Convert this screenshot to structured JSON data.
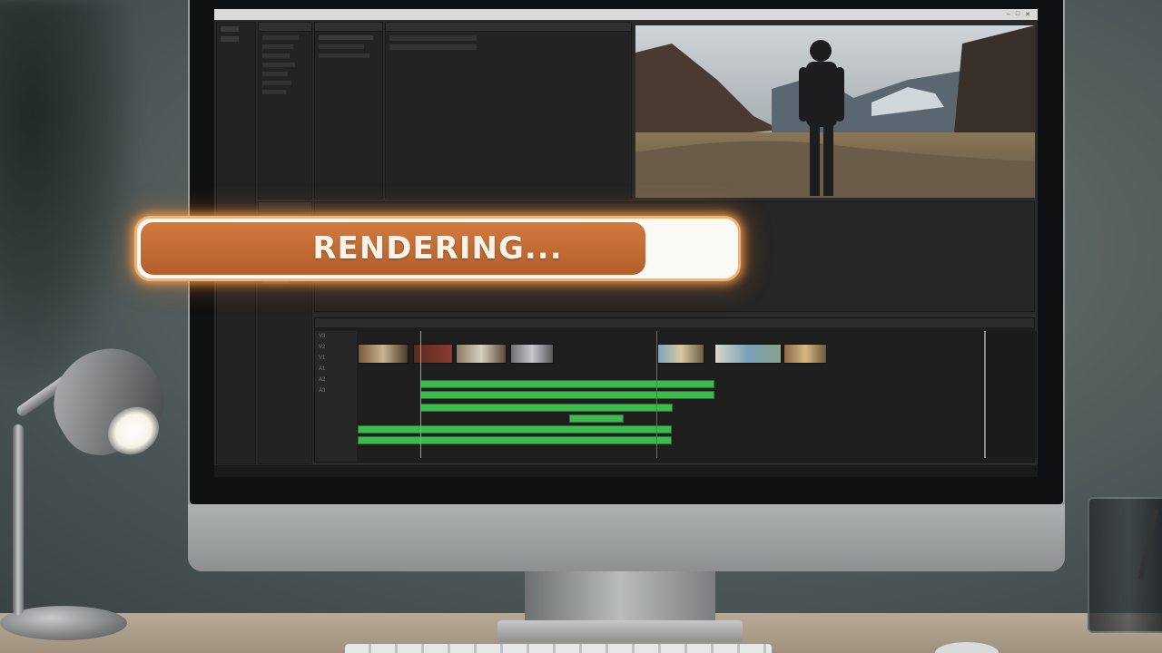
{
  "window": {
    "title": "",
    "controls": [
      "–",
      "□",
      "✕"
    ]
  },
  "panels": {
    "project_tabs": [
      "",
      "",
      ""
    ],
    "effects_list": [
      "",
      "",
      "",
      "",
      "",
      "",
      ""
    ],
    "source_tabs": [
      "",
      ""
    ],
    "inspector_rows": [
      "",
      "",
      "",
      "",
      "",
      "",
      "",
      "",
      ""
    ],
    "timeline_ruler": [
      "",
      "",
      "",
      "",
      "",
      ""
    ],
    "track_labels": [
      "V3",
      "V2",
      "V1",
      "A1",
      "A2",
      "A3"
    ],
    "bottom_bar": [
      "",
      "",
      "",
      "",
      ""
    ]
  },
  "render": {
    "label": "RENDERING...",
    "progress": 0.85
  },
  "colors": {
    "render_fill": "#c46c33",
    "render_glow": "#ffa850",
    "audio_clip": "#3dbb4f"
  }
}
